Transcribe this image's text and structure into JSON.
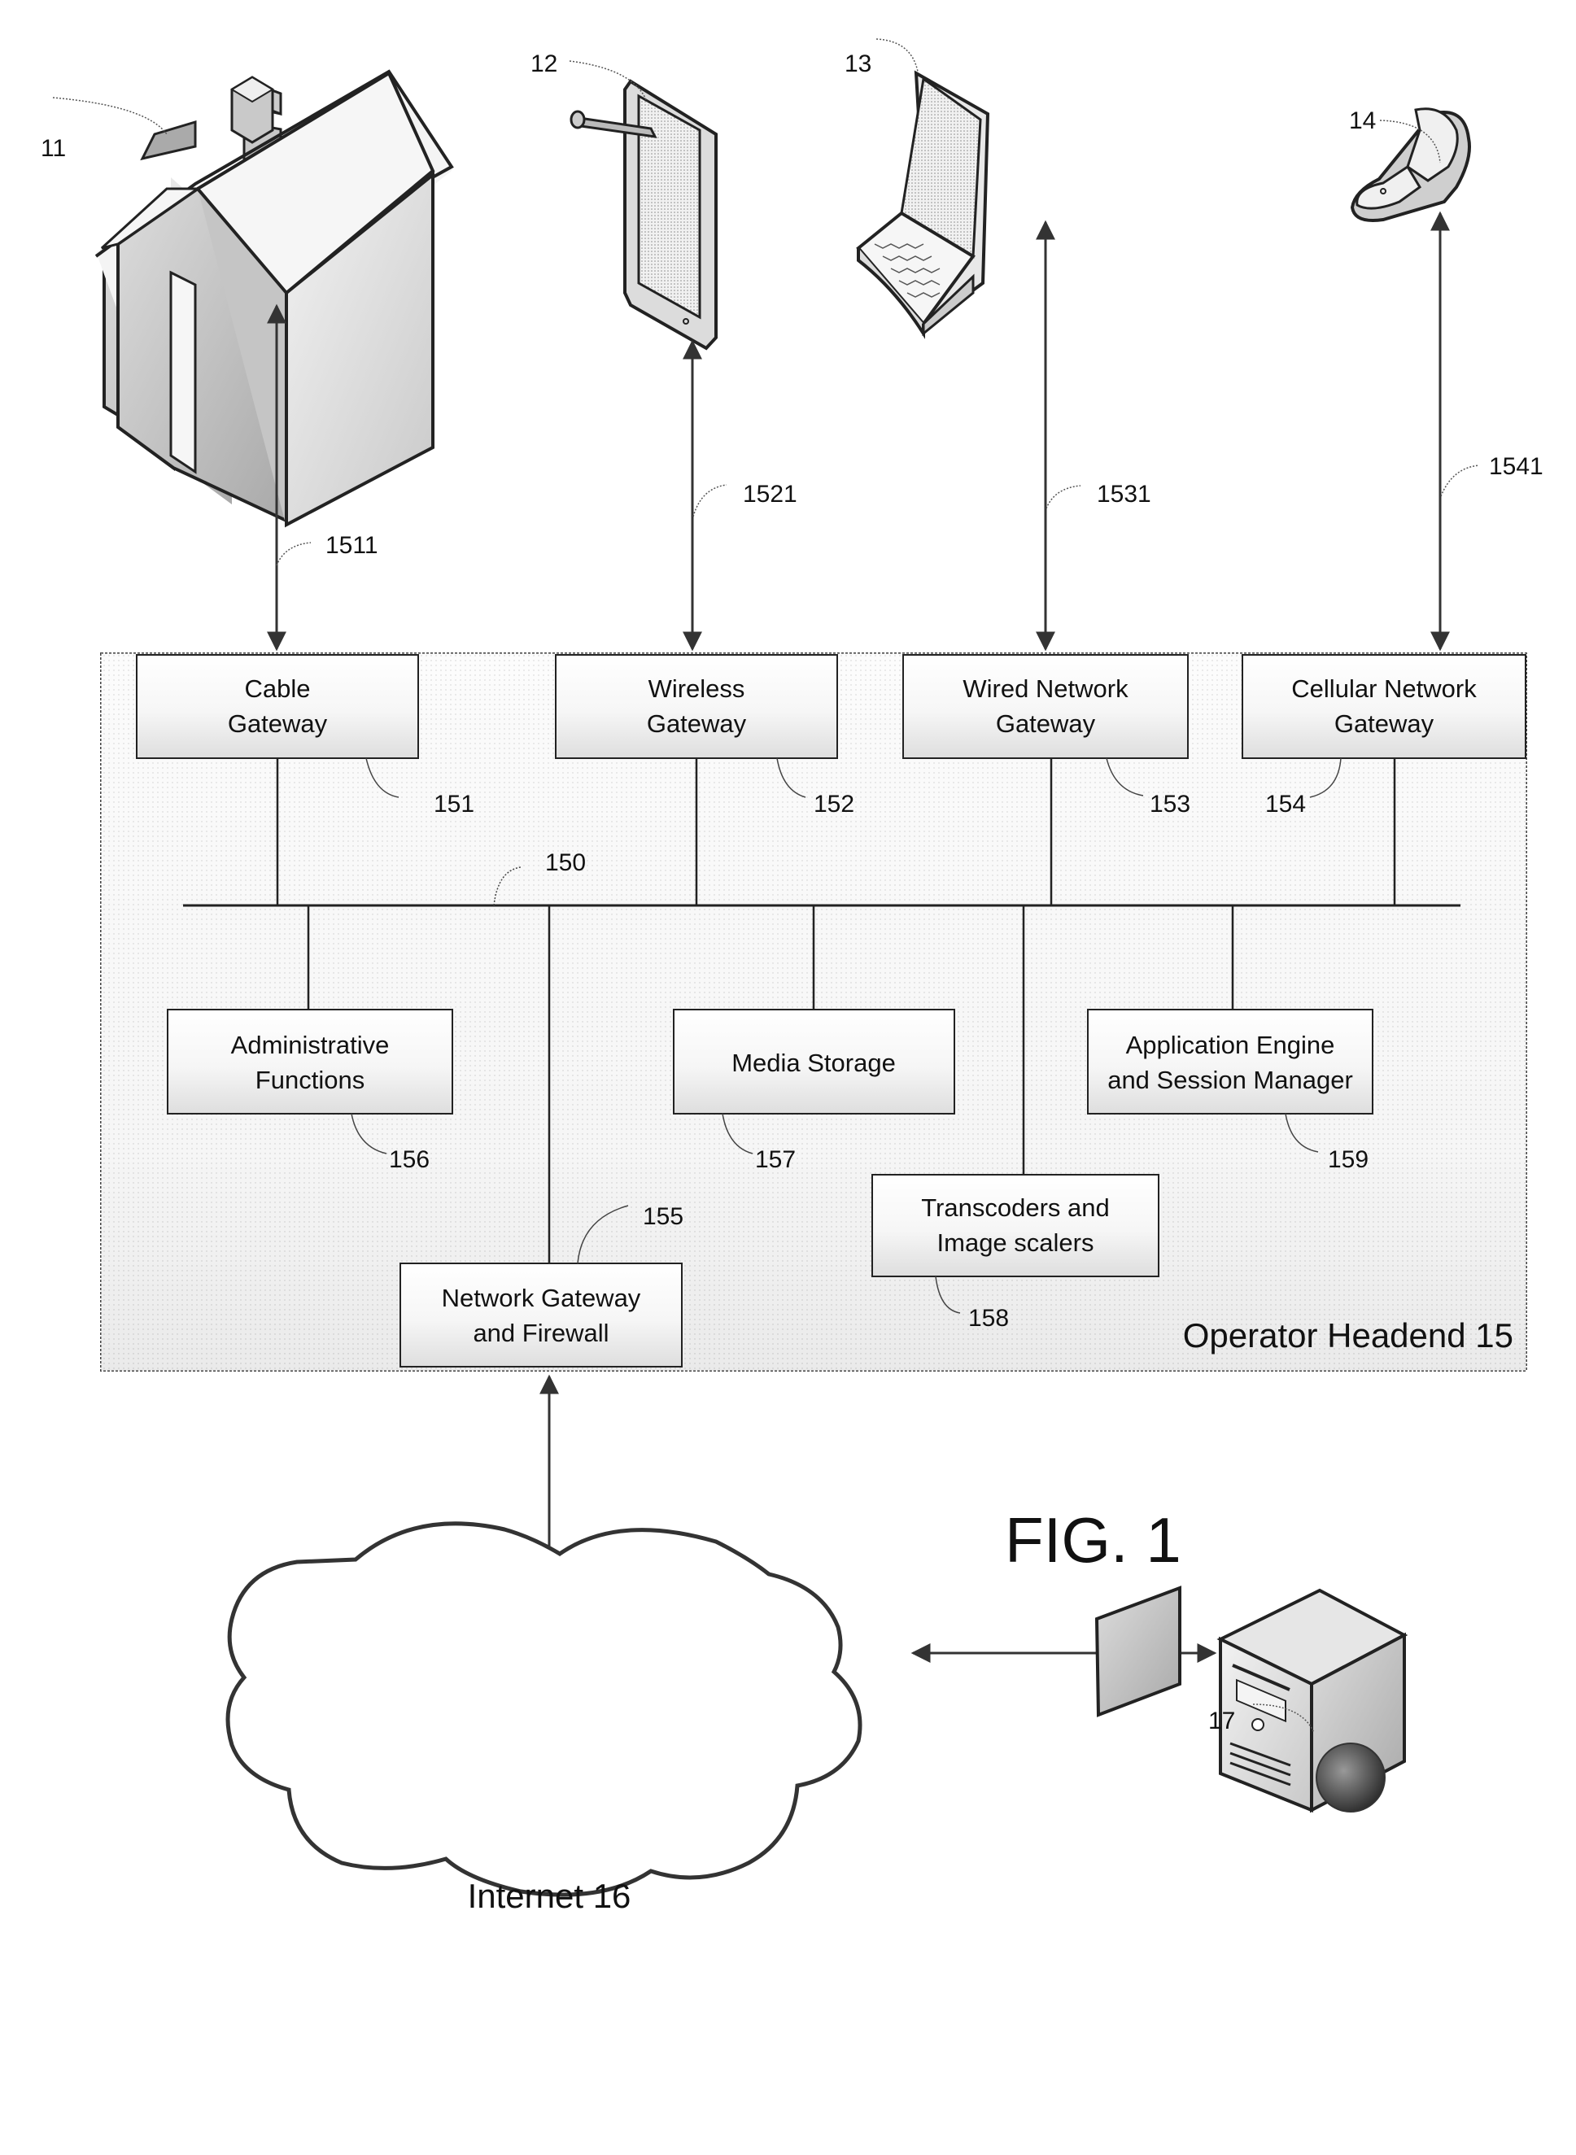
{
  "figure": {
    "title": "FIG. 1"
  },
  "devices": [
    {
      "id": "house",
      "ref": "11",
      "icon": "house-icon"
    },
    {
      "id": "tablet",
      "ref": "12",
      "icon": "tablet-icon"
    },
    {
      "id": "laptop",
      "ref": "13",
      "icon": "laptop-icon"
    },
    {
      "id": "phone",
      "ref": "14",
      "icon": "flip-phone-icon"
    }
  ],
  "links": [
    {
      "ref": "1511",
      "from": "house",
      "to": "cable-gateway"
    },
    {
      "ref": "1521",
      "from": "tablet",
      "to": "wireless-gateway"
    },
    {
      "ref": "1531",
      "from": "laptop",
      "to": "wired-network-gateway"
    },
    {
      "ref": "1541",
      "from": "phone",
      "to": "cellular-network-gateway"
    }
  ],
  "headend": {
    "label": "Operator Headend 15",
    "bus_ref": "150",
    "gateways": [
      {
        "lines": [
          "Cable",
          "Gateway"
        ],
        "ref": "151"
      },
      {
        "lines": [
          "Wireless",
          "Gateway"
        ],
        "ref": "152"
      },
      {
        "lines": [
          "Wired Network",
          "Gateway"
        ],
        "ref": "153"
      },
      {
        "lines": [
          "Cellular Network",
          "Gateway"
        ],
        "ref": "154"
      }
    ],
    "components": [
      {
        "lines": [
          "Administrative",
          "Functions"
        ],
        "ref": "156"
      },
      {
        "lines": [
          "Media Storage"
        ],
        "ref": "157"
      },
      {
        "lines": [
          "Application Engine",
          "and Session Manager"
        ],
        "ref": "159"
      },
      {
        "lines": [
          "Transcoders and",
          "Image scalers"
        ],
        "ref": "158"
      },
      {
        "lines": [
          "Network Gateway",
          "and Firewall"
        ],
        "ref": "155"
      }
    ]
  },
  "internet": {
    "label": "Internet 16"
  },
  "server": {
    "ref": "17",
    "icon": "web-server-icon"
  }
}
